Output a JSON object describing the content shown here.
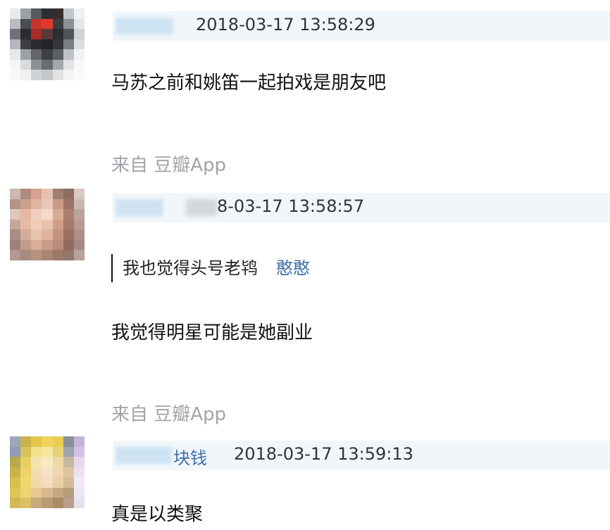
{
  "comments": [
    {
      "time": "2018-03-17 13:58:29",
      "text": "马苏之前和姚笛一起拍戏是朋友吧",
      "source": "来自 豆瓣App",
      "avatar_palette": [
        "#e8eaec",
        "#9aa0a6",
        "#555a5f",
        "#2e2f33",
        "#3a2c2c",
        "#c2c6ca",
        "#f0f1f2",
        "#b9bdc1",
        "#4a4d52",
        "#c8342c",
        "#e03a30",
        "#3b3d42",
        "#8d9196",
        "#e4e6e8",
        "#6f7378",
        "#2b2c30",
        "#a92b27",
        "#5a3a38",
        "#2c2d31",
        "#505459",
        "#d0d3d6",
        "#b4b8bc",
        "#3c3e43",
        "#2a2b2f",
        "#23242a",
        "#34363b",
        "#7a7e83",
        "#dcdfe2",
        "#e6e8ea",
        "#9da1a6",
        "#62666b",
        "#3d3f44",
        "#5c6065",
        "#bfc3c7",
        "#f2f3f4",
        "#f4f5f6",
        "#d8dbde",
        "#8c9095",
        "#696d72",
        "#a3a7ac",
        "#e1e3e5",
        "#f6f7f8",
        "#f7f8f9",
        "#eef0f1",
        "#cfd2d5",
        "#c5c8cb",
        "#dfe1e3",
        "#f3f4f5",
        "#f9f9fa"
      ]
    },
    {
      "time": "8-03-17 13:58:57",
      "quote_text": "我也觉得头号老鸨",
      "quote_author": "憨憨",
      "text": "我觉得明星可能是她副业",
      "source": "来自 豆瓣App",
      "avatar_palette": [
        "#c9b9b2",
        "#b08a7e",
        "#d8a18f",
        "#e7c1b0",
        "#a27d72",
        "#8f6c62",
        "#d9c9c3",
        "#b59488",
        "#caa08f",
        "#e1b59f",
        "#eac7b6",
        "#c79a86",
        "#9c7466",
        "#cbb9b1",
        "#dcc7bd",
        "#e4b8a2",
        "#efd0bf",
        "#f3d9ca",
        "#d9ab95",
        "#ab8072",
        "#bca49a",
        "#c5a69a",
        "#e6bca6",
        "#f0cdb9",
        "#e8c2ad",
        "#cf9f89",
        "#a57a6b",
        "#b89b90",
        "#a88e84",
        "#d6ad98",
        "#e9c4af",
        "#deb49e",
        "#c39280",
        "#9a7062",
        "#ad9186",
        "#9c8278",
        "#c29b89",
        "#d8ae99",
        "#c99c88",
        "#b88c7a",
        "#8f6a5d",
        "#a48a80",
        "#b19a91",
        "#a88a7e",
        "#b9917f",
        "#ac8472",
        "#9d7868",
        "#93776c",
        "#b6a39b"
      ]
    },
    {
      "name_visible": "块钱",
      "time": "2018-03-17 13:59:13",
      "text": "真是以类聚",
      "avatar_palette": [
        "#9aa8b8",
        "#c9b24a",
        "#e3c64a",
        "#f1d45c",
        "#e9cd55",
        "#8a8f9c",
        "#c6b3d8",
        "#8e9cb8",
        "#d7c35a",
        "#f3e08a",
        "#f7e7a0",
        "#e8d27a",
        "#9fa4b0",
        "#d3c1e2",
        "#b6a94e",
        "#e7cf63",
        "#f5e4b0",
        "#f8e9c2",
        "#f1d9a4",
        "#c7b8a0",
        "#e6d8ee",
        "#cbb24a",
        "#edd36a",
        "#f2dcb0",
        "#f6e2c4",
        "#efd6ae",
        "#dcc4a4",
        "#ede2f2",
        "#d8bd50",
        "#f0d76f",
        "#f3d9a8",
        "#f4dcbc",
        "#e9cfa6",
        "#d4bb98",
        "#f1e9f5",
        "#e0c558",
        "#efd470",
        "#e9c994",
        "#d8b88c",
        "#c7a882",
        "#b79c7c",
        "#eee6f3",
        "#d2b954",
        "#dcc062",
        "#c9a97e",
        "#b99a74",
        "#a98c6c",
        "#b7a08a",
        "#e8e0ee"
      ]
    }
  ]
}
